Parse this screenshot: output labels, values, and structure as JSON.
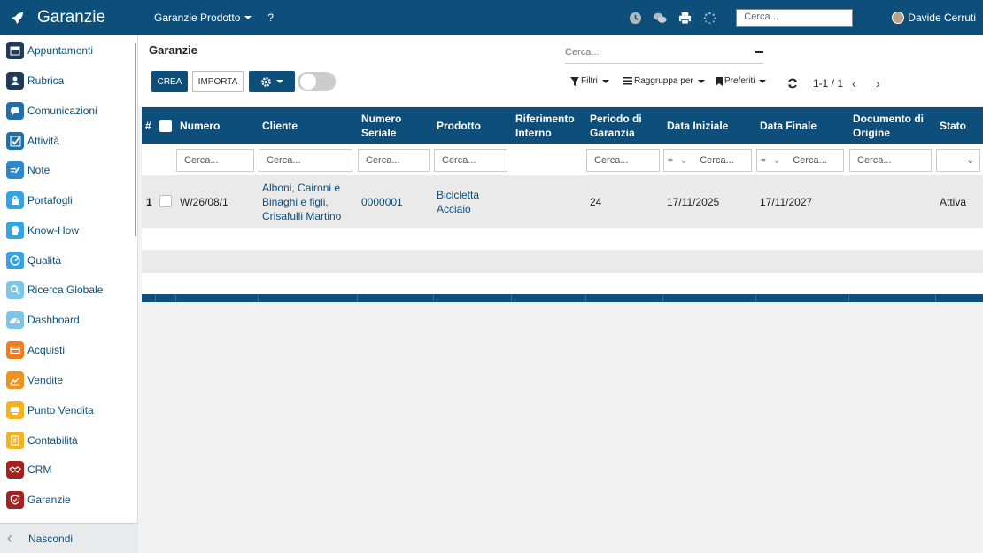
{
  "app": {
    "title": "Garanzie"
  },
  "topbar": {
    "menu_label": "Garanzie Prodotto",
    "help_label": "?",
    "search_placeholder": "Cerca...",
    "user_name": "Davide Cerruti",
    "icons": [
      "clock-icon",
      "chat-icon",
      "print-icon",
      "spinner-icon"
    ]
  },
  "sidebar": {
    "items": [
      {
        "label": "Appuntamenti",
        "icon": "calendar-icon",
        "color": "#1f3b57"
      },
      {
        "label": "Rubrica",
        "icon": "contacts-icon",
        "color": "#1f3b57"
      },
      {
        "label": "Comunicazioni",
        "icon": "message-icon",
        "color": "#1f6fa8"
      },
      {
        "label": "Attività",
        "icon": "check-icon",
        "color": "#1f6fa8"
      },
      {
        "label": "Note",
        "icon": "note-icon",
        "color": "#2d87c9"
      },
      {
        "label": "Portafogli",
        "icon": "lock-icon",
        "color": "#36a3e0"
      },
      {
        "label": "Know-How",
        "icon": "head-icon",
        "color": "#36a3e0"
      },
      {
        "label": "Qualità",
        "icon": "gauge-icon",
        "color": "#36a3e0"
      },
      {
        "label": "Ricerca Globale",
        "icon": "search-icon",
        "color": "#7cc6ea"
      },
      {
        "label": "Dashboard",
        "icon": "dashboard-icon",
        "color": "#7cc6ea"
      },
      {
        "label": "Acquisti",
        "icon": "card-icon",
        "color": "#ef7d1a"
      },
      {
        "label": "Vendite",
        "icon": "chart-icon",
        "color": "#f0931e"
      },
      {
        "label": "Punto Vendita",
        "icon": "pos-icon",
        "color": "#f6b21c"
      },
      {
        "label": "Contabilità",
        "icon": "ledger-icon",
        "color": "#f6b21c"
      },
      {
        "label": "CRM",
        "icon": "handshake-icon",
        "color": "#a3221f"
      },
      {
        "label": "Garanzie",
        "icon": "shield-icon",
        "color": "#a3221f"
      }
    ],
    "hide_label": "Nascondi"
  },
  "control": {
    "title": "Garanzie",
    "search_placeholder": "Cerca...",
    "create_label": "CREA",
    "import_label": "IMPORTA",
    "filters_label": "Filtri",
    "groupby_label": "Raggruppa per",
    "favorites_label": "Preferiti",
    "pager": "1-1 / 1"
  },
  "table": {
    "headers": {
      "index": "#",
      "numero": "Numero",
      "cliente": "Cliente",
      "seriale": [
        "Numero",
        "Seriale"
      ],
      "prodotto": "Prodotto",
      "riferimento": [
        "Riferimento",
        "Interno"
      ],
      "periodo": [
        "Periodo di",
        "Garanzia"
      ],
      "data_iniziale": "Data Iniziale",
      "data_finale": "Data Finale",
      "documento": [
        "Documento di",
        "Origine"
      ],
      "stato": "Stato"
    },
    "filter_placeholder": "Cerca...",
    "filter_operator": "=",
    "rows": [
      {
        "index": "1",
        "numero": "W/26/08/1",
        "cliente": [
          "Alboni, Caironi e",
          "Binaghi e figli,",
          "Crisafulli Martino"
        ],
        "seriale": "0000001",
        "prodotto": [
          "Bicicletta",
          "Acciaio"
        ],
        "riferimento": "",
        "periodo": "24",
        "data_iniziale": "17/11/2025",
        "data_finale": "17/11/2027",
        "documento": "",
        "stato": "Attiva"
      }
    ]
  }
}
